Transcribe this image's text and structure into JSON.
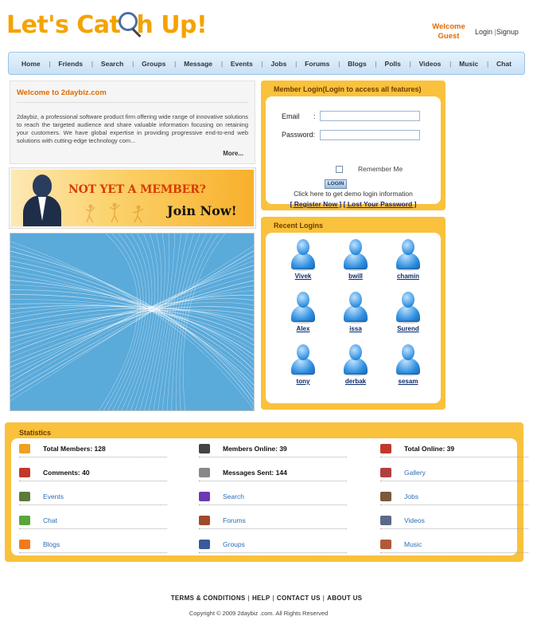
{
  "header": {
    "logo_text": "Let's Catch Up!",
    "welcome_line1": "Welcome",
    "welcome_line2": "Guest",
    "login_link": "Login",
    "signup_link": "Signup"
  },
  "nav": [
    "Home",
    "Friends",
    "Search",
    "Groups",
    "Message",
    "Events",
    "Jobs",
    "Forums",
    "Blogs",
    "Polls",
    "Videos",
    "Music",
    "Chat"
  ],
  "welcome_box": {
    "title": "Welcome to 2daybiz.com",
    "body": "2daybiz, a professional software product firm offering wide range of innovative solutions to reach the targeted audience and share valuable information focusing on retaining your customers. We have global expertise in providing progressive end-to-end web solutions with cutting-edge technology com...",
    "more": "More..."
  },
  "banner": {
    "headline": "NOT YET A MEMBER?",
    "cta": "Join Now!"
  },
  "login": {
    "title": "Member Login(Login to access all features)",
    "email_label": "Email",
    "colon": ":",
    "password_label": "Password:",
    "remember": "Remember Me",
    "button": "LOGIN",
    "demo_text": "Click here to get demo login information",
    "register": "[ Register Now ]",
    "lost_password": "[ Lost Your Password ]"
  },
  "recent": {
    "title": "Recent Logins",
    "users": [
      "Vivek",
      "bwill",
      "chamin",
      "Alex",
      "issa",
      "Surend",
      "tony",
      "derbak",
      "sesam"
    ]
  },
  "stats": {
    "title": "Statistics",
    "rows": [
      [
        {
          "text": "Total Members: 128",
          "bold": true,
          "icon": "members-icon",
          "color": "#f0a020"
        },
        {
          "text": "Members Online: 39",
          "bold": true,
          "icon": "members-online-icon",
          "color": "#444"
        },
        {
          "text": "Total Online: 39",
          "bold": true,
          "icon": "total-online-icon",
          "color": "#c0392b"
        }
      ],
      [
        {
          "text": "Comments: 40",
          "bold": true,
          "icon": "comments-icon",
          "color": "#c0392b"
        },
        {
          "text": "Messages Sent: 144",
          "bold": true,
          "icon": "messages-icon",
          "color": "#888"
        },
        {
          "text": "Gallery",
          "bold": false,
          "icon": "gallery-icon",
          "color": "#b04040"
        }
      ],
      [
        {
          "text": "Events",
          "bold": false,
          "icon": "events-icon",
          "color": "#5b7a3a"
        },
        {
          "text": "Search",
          "bold": false,
          "icon": "search-icon",
          "color": "#6a3ab0"
        },
        {
          "text": "Jobs",
          "bold": false,
          "icon": "jobs-icon",
          "color": "#7a5a3a"
        }
      ],
      [
        {
          "text": "Chat",
          "bold": false,
          "icon": "chat-icon",
          "color": "#5aa63a"
        },
        {
          "text": "Forums",
          "bold": false,
          "icon": "forums-icon",
          "color": "#a04a2a"
        },
        {
          "text": "Videos",
          "bold": false,
          "icon": "videos-icon",
          "color": "#5a6a8a"
        }
      ],
      [
        {
          "text": "Blogs",
          "bold": false,
          "icon": "blogs-icon",
          "color": "#f07a20"
        },
        {
          "text": "Groups",
          "bold": false,
          "icon": "groups-icon",
          "color": "#3a5a9a"
        },
        {
          "text": "Music",
          "bold": false,
          "icon": "music-icon",
          "color": "#b05a3a"
        }
      ]
    ]
  },
  "footer": {
    "links": [
      "TERMS & CONDITIONS",
      "HELP",
      "CONTACT US",
      "ABOUT US"
    ],
    "copyright": "Copyright © 2009 2daybiz .com. All Rights Reserved"
  },
  "colors": {
    "accent": "#f4a300",
    "panel": "#f9c13c",
    "nav_bg": "#d6e9fb",
    "link": "#2d6db5"
  }
}
